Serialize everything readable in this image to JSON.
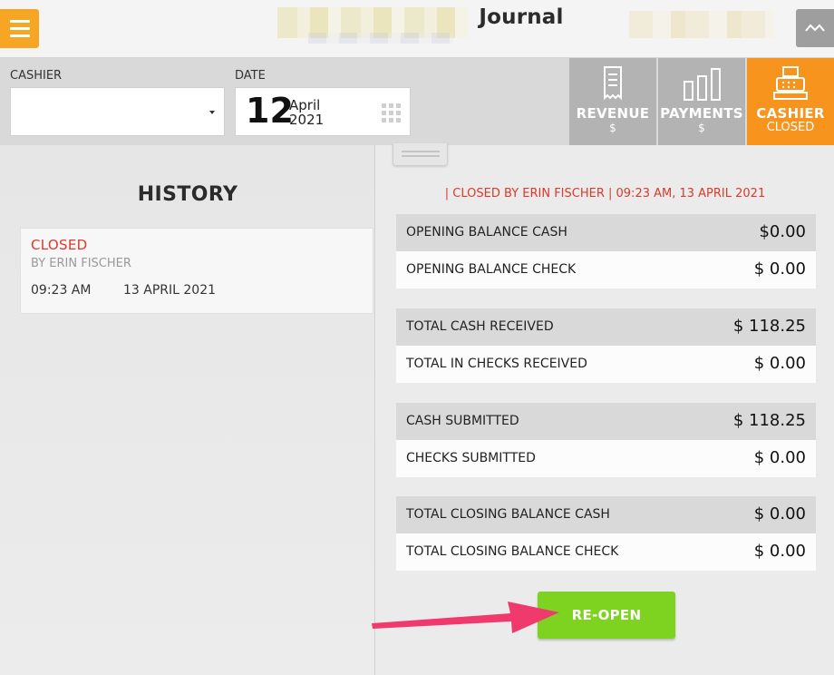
{
  "header": {
    "title": "Journal"
  },
  "filters": {
    "cashier_label": "CASHIER",
    "cashier_value": "",
    "date_label": "DATE",
    "date_day": "12",
    "date_month": "April",
    "date_year": "2021"
  },
  "tabs": [
    {
      "label": "REVENUE",
      "sub": "$",
      "icon": "receipt-icon"
    },
    {
      "label": "PAYMENTS",
      "sub": "$",
      "icon": "bar-chart-icon"
    },
    {
      "label": "CASHIER",
      "sub": "CLOSED",
      "icon": "cash-register-icon",
      "active": true
    }
  ],
  "history": {
    "title": "HISTORY",
    "items": [
      {
        "status": "CLOSED",
        "by": "BY ERIN FISCHER",
        "time": "09:23 AM",
        "date": "13 APRIL 2021"
      }
    ]
  },
  "summary": {
    "closed_by": "| CLOSED BY ERIN FISCHER | 09:23 AM, 13 APRIL 2021",
    "rows": [
      {
        "label": "OPENING BALANCE CASH",
        "value": "$0.00"
      },
      {
        "label": "OPENING BALANCE CHECK",
        "value": "$ 0.00"
      },
      {
        "label": "TOTAL CASH RECEIVED",
        "value": "$ 118.25"
      },
      {
        "label": "TOTAL IN CHECKS RECEIVED",
        "value": "$ 0.00"
      },
      {
        "label": "CASH SUBMITTED",
        "value": "$ 118.25"
      },
      {
        "label": "CHECKS SUBMITTED",
        "value": "$ 0.00"
      },
      {
        "label": "TOTAL CLOSING BALANCE CASH",
        "value": "$ 0.00"
      },
      {
        "label": "TOTAL CLOSING BALANCE CHECK",
        "value": "$ 0.00"
      }
    ],
    "reopen_label": "RE-OPEN"
  },
  "colors": {
    "accent_orange": "#f7941d",
    "menu_orange": "#f6a623",
    "reopen_green": "#7ed321",
    "closed_red": "#d93a2b",
    "annotation_arrow": "#f03a6e"
  }
}
